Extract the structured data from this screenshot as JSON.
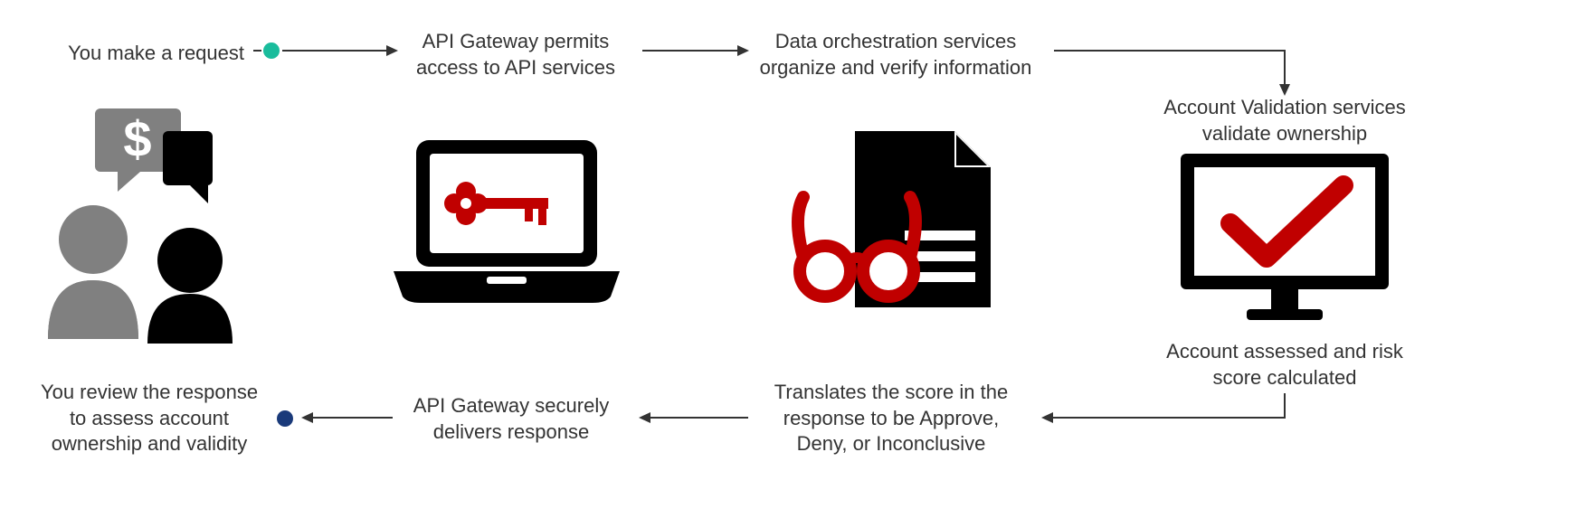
{
  "steps": {
    "s1": "You make a request",
    "s2a": "API Gateway permits",
    "s2b": "access to API services",
    "s3a": "Data orchestration services",
    "s3b": "organize and verify information",
    "s4a": "Account Validation services",
    "s4b": "validate ownership",
    "s5a": "Account assessed and risk",
    "s5b": "score calculated",
    "s6a": "Translates the score in the",
    "s6b": "response to be Approve,",
    "s6c": "Deny, or Inconclusive",
    "s7a": "API Gateway securely",
    "s7b": "delivers response",
    "s8a": "You review the response",
    "s8b": "to assess account",
    "s8c": "ownership and validity"
  },
  "colors": {
    "red": "#c00000",
    "black": "#000000",
    "gray": "#808080",
    "teal": "#1abc9c",
    "navy": "#1a3a7a"
  }
}
